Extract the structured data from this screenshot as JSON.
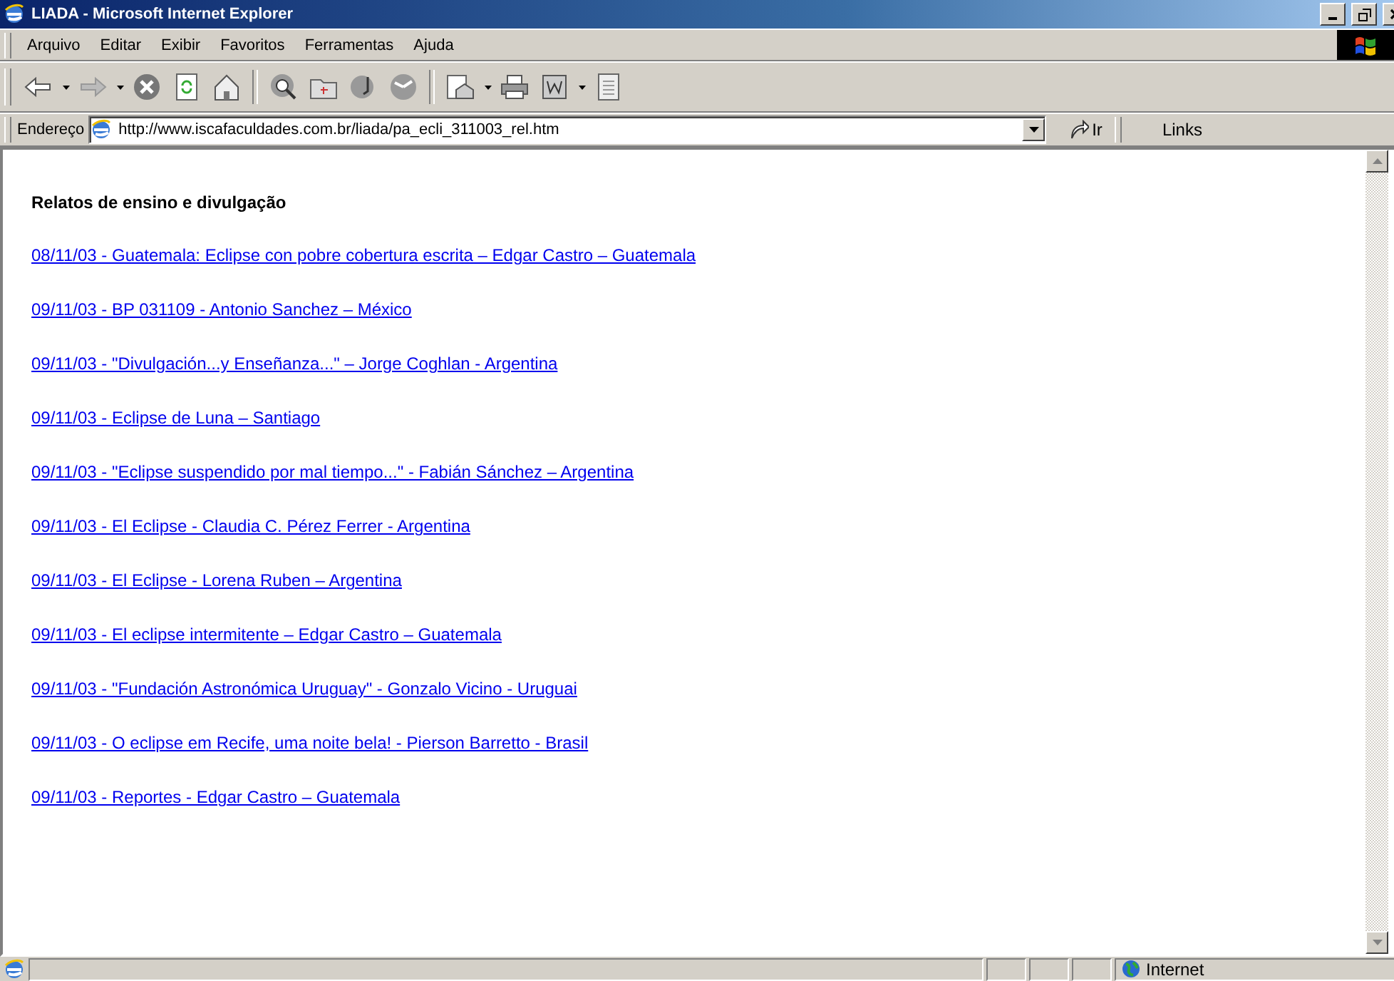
{
  "window": {
    "title": "LIADA - Microsoft Internet Explorer"
  },
  "menu": [
    "Arquivo",
    "Editar",
    "Exibir",
    "Favoritos",
    "Ferramentas",
    "Ajuda"
  ],
  "address_bar": {
    "label": "Endereço",
    "url": "http://www.iscafaculdades.com.br/liada/pa_ecli_311003_rel.htm",
    "go": "Ir",
    "links": "Links"
  },
  "page": {
    "heading": "Relatos de ensino e divulgação",
    "links": [
      "08/11/03 - Guatemala: Eclipse con pobre cobertura escrita – Edgar Castro – Guatemala",
      "09/11/03 - BP 031109 - Antonio Sanchez – México",
      "09/11/03 - \"Divulgación...y Enseñanza...\" – Jorge Coghlan - Argentina",
      "09/11/03 - Eclipse de Luna – Santiago",
      "09/11/03 - \"Eclipse suspendido por mal tiempo...\" - Fabián Sánchez – Argentina",
      "09/11/03 - El Eclipse - Claudia C. Pérez Ferrer - Argentina",
      "09/11/03 - El Eclipse - Lorena Ruben – Argentina",
      "09/11/03 - El eclipse intermitente – Edgar Castro – Guatemala",
      "09/11/03 - \"Fundación Astronómica Uruguay\" - Gonzalo Vicino - Uruguai",
      "09/11/03 - O eclipse em Recife, uma noite bela! - Pierson Barretto - Brasil",
      "09/11/03 - Reportes - Edgar Castro – Guatemala"
    ]
  },
  "status_bar": {
    "zone": "Internet"
  }
}
